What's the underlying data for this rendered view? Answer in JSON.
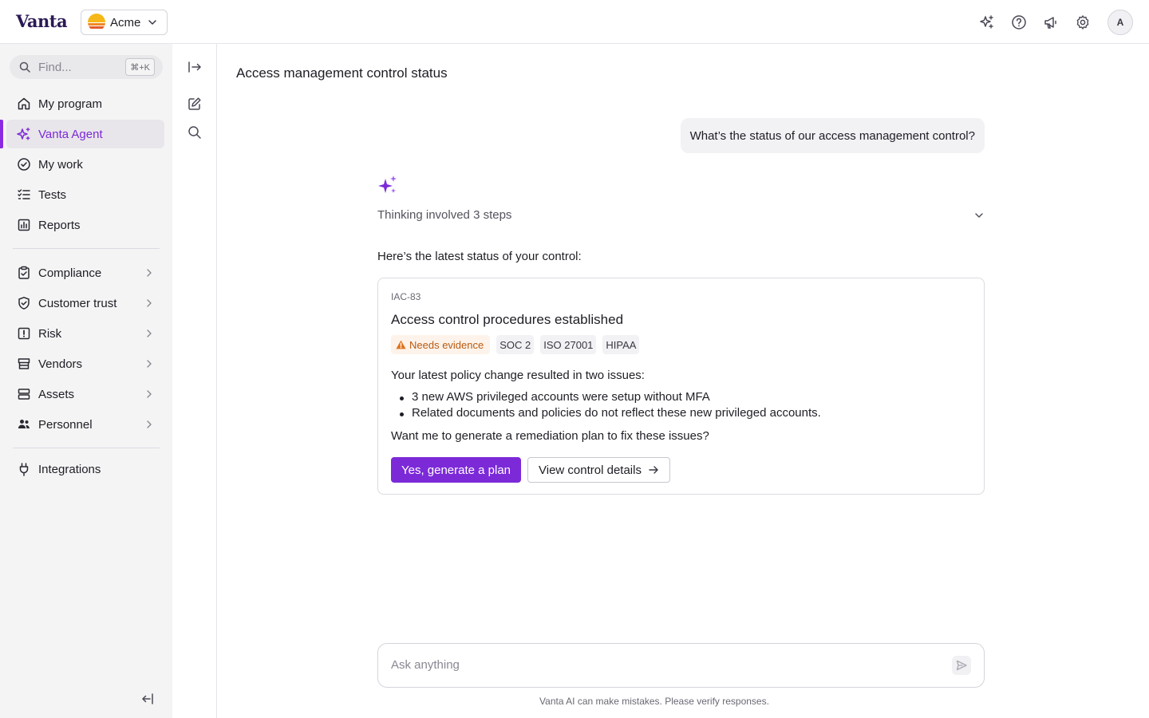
{
  "app": {
    "logo": "Vanta",
    "org_name": "Acme"
  },
  "topbar": {
    "icons": [
      "ai-sparkle-icon",
      "help-icon",
      "announcements-icon",
      "settings-icon"
    ],
    "avatar_initial": "A"
  },
  "sidebar": {
    "search_placeholder": "Find...",
    "search_shortcut": "⌘+K",
    "items": [
      {
        "label": "My program",
        "icon": "home-icon"
      },
      {
        "label": "Vanta Agent",
        "icon": "sparkle-icon",
        "active": true
      },
      {
        "label": "My work",
        "icon": "check-circle-icon"
      },
      {
        "label": "Tests",
        "icon": "checklist-icon"
      },
      {
        "label": "Reports",
        "icon": "chart-icon"
      },
      {
        "label": "Compliance",
        "icon": "clipboard-icon",
        "expandable": true
      },
      {
        "label": "Customer trust",
        "icon": "shield-icon",
        "expandable": true
      },
      {
        "label": "Risk",
        "icon": "alert-square-icon",
        "expandable": true
      },
      {
        "label": "Vendors",
        "icon": "store-icon",
        "expandable": true
      },
      {
        "label": "Assets",
        "icon": "server-icon",
        "expandable": true
      },
      {
        "label": "Personnel",
        "icon": "people-icon",
        "expandable": true
      },
      {
        "label": "Integrations",
        "icon": "plug-icon"
      }
    ]
  },
  "rail": {
    "icons": [
      "expand-panel-icon",
      "new-chat-icon",
      "search-icon"
    ]
  },
  "main": {
    "title": "Access management control status",
    "user_message": "What’s the status of our access management control?",
    "thinking": "Thinking involved 3 steps",
    "intro": "Here’s the latest status of your control:",
    "card": {
      "control_id": "IAC-83",
      "control_title": "Access control procedures established",
      "status_tag": "Needs evidence",
      "framework_tags": [
        "SOC 2",
        "ISO 27001",
        "HIPAA"
      ],
      "summary": "Your latest policy change resulted in two issues:",
      "issues": [
        "3 new AWS privileged accounts were setup without MFA",
        "Related documents and policies do not reflect these new privileged accounts."
      ],
      "question": "Want me to generate a remediation plan to fix these issues?",
      "primary_button": "Yes, generate a plan",
      "secondary_button": "View control details"
    },
    "composer_placeholder": "Ask anything",
    "disclaimer": "Vanta AI can make mistakes. Please verify responses."
  },
  "colors": {
    "accent": "#7c2ad8",
    "warning": "#b85a12",
    "warning_bg": "#fdf3ea",
    "sidebar_bg": "#f4f4f5"
  }
}
